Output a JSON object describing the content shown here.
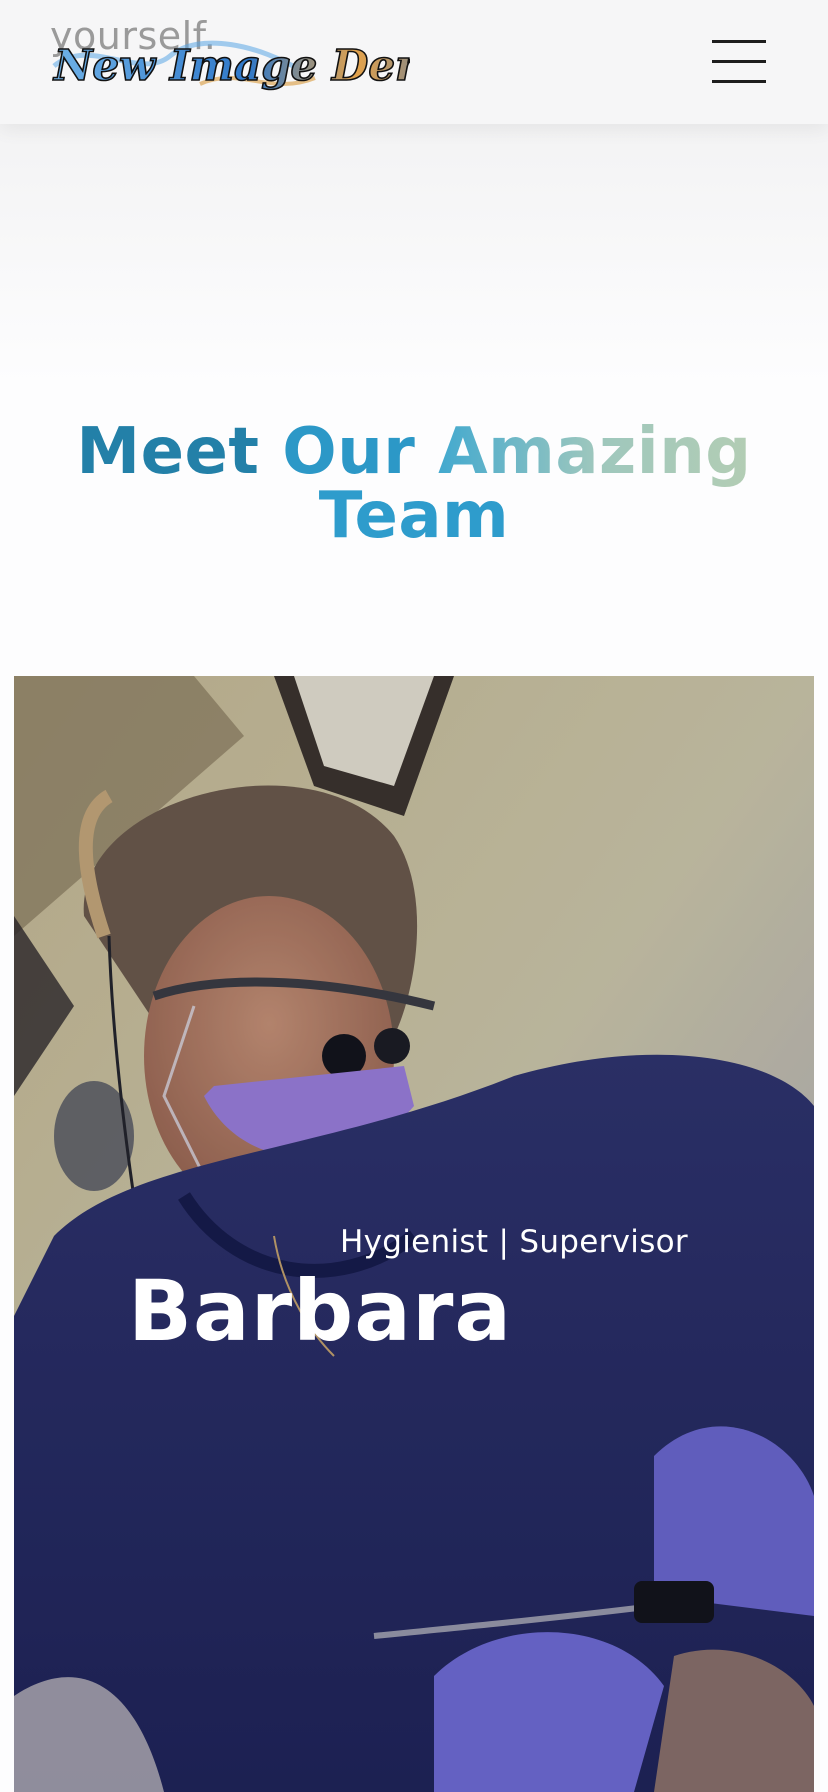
{
  "header": {
    "bleed_text": "yourself.",
    "logo_text": "New Image Dental",
    "menu_icon": "hamburger-menu-icon"
  },
  "team_section": {
    "title_words": [
      "Meet",
      "Our",
      "Amazing",
      "Team"
    ]
  },
  "team_card": {
    "name": "Barbara",
    "role": "Hygienist | Supervisor",
    "photo_description_icon": "team-member-photo"
  },
  "colors": {
    "title_blue_dark": "#2380a8",
    "title_blue": "#2c98c7",
    "title_gradient_end": "#b3cdb4",
    "scrubs_navy": "#262a5c",
    "mask_purple": "#9b7ed6"
  }
}
